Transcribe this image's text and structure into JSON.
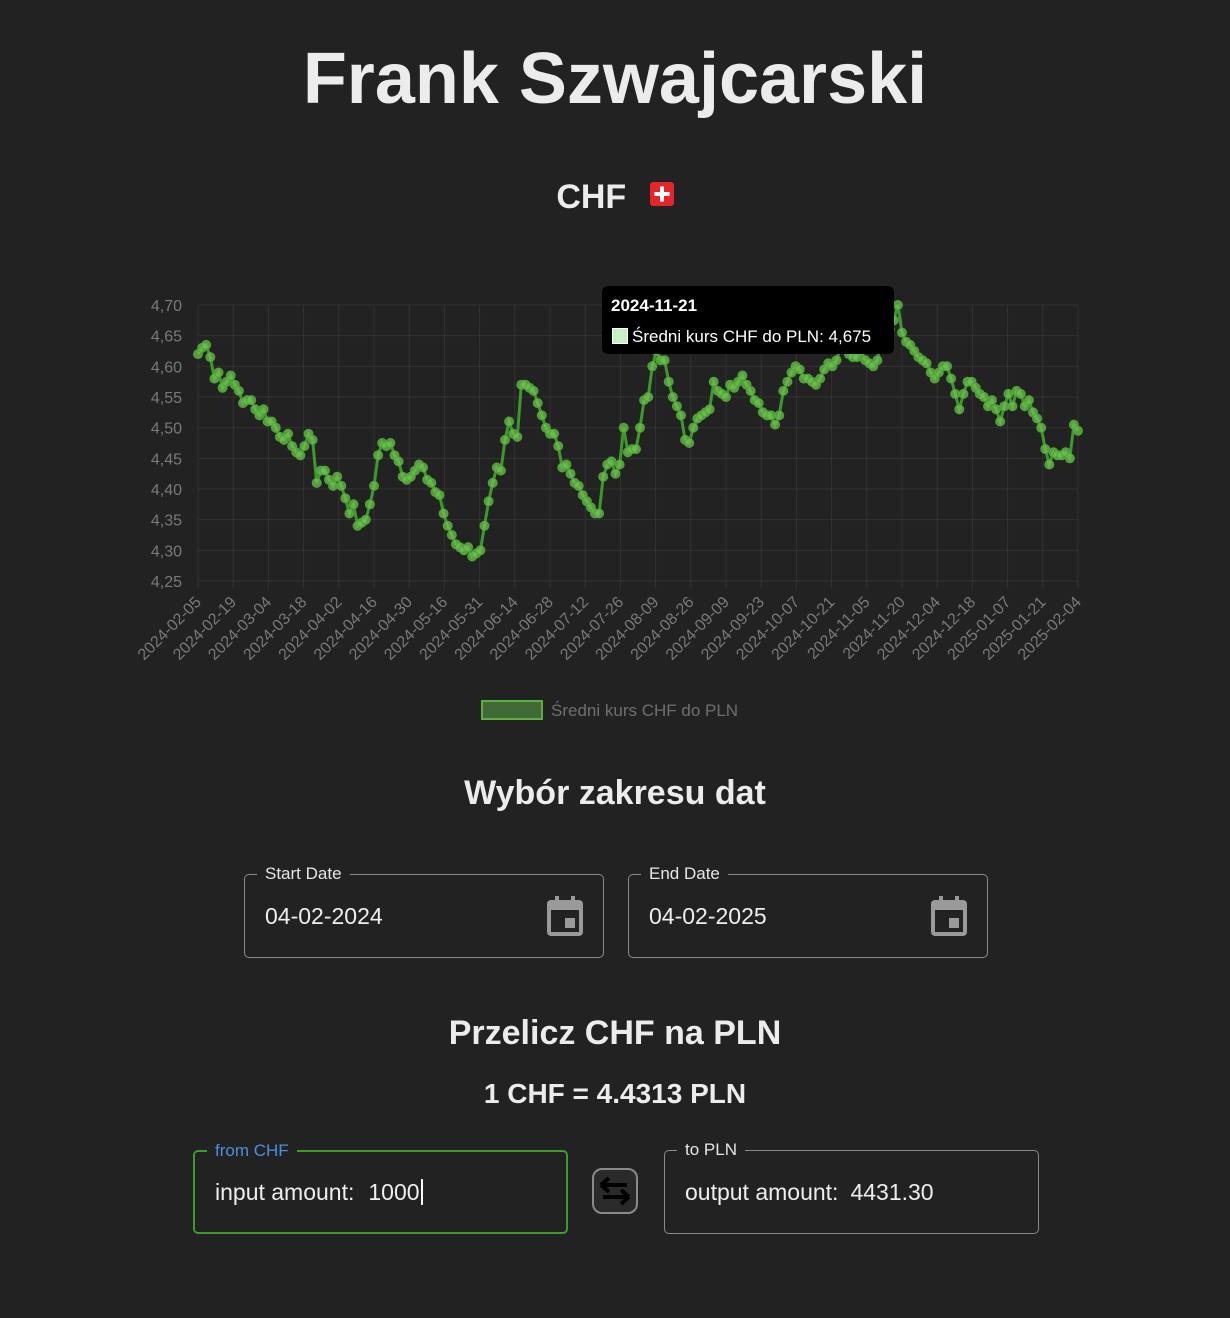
{
  "app_title": "Frank Szwajcarski",
  "currency": {
    "code": "CHF",
    "flag_icon": "swiss-flag-icon"
  },
  "colors": {
    "background": "#222222",
    "line": "#3d9a2a",
    "point": "#6ec24f",
    "focus_border": "#3b9b2b",
    "focus_label": "#4a8fe0"
  },
  "tooltip": {
    "title": "2024-11-21",
    "body": "Średni kurs CHF do PLN: 4,675"
  },
  "chart_data": {
    "type": "line",
    "series_name": "Średni kurs CHF do PLN",
    "y_ticks": [
      "4,70",
      "4,65",
      "4,60",
      "4,55",
      "4,50",
      "4,45",
      "4,40",
      "4,35",
      "4,30",
      "4,25"
    ],
    "ylim": [
      4.25,
      4.7
    ],
    "x_ticks": [
      "2024-02-05",
      "2024-02-19",
      "2024-03-04",
      "2024-03-18",
      "2024-04-02",
      "2024-04-16",
      "2024-04-30",
      "2024-05-16",
      "2024-05-31",
      "2024-06-14",
      "2024-06-28",
      "2024-07-12",
      "2024-07-26",
      "2024-08-09",
      "2024-08-26",
      "2024-09-09",
      "2024-09-23",
      "2024-10-07",
      "2024-10-21",
      "2024-11-05",
      "2024-11-20",
      "2024-12-04",
      "2024-12-18",
      "2025-01-07",
      "2025-01-21",
      "2025-02-04"
    ],
    "legend_position": "bottom",
    "grid": true,
    "values": [
      4.62,
      4.63,
      4.635,
      4.615,
      4.58,
      4.59,
      4.565,
      4.575,
      4.585,
      4.57,
      4.56,
      4.54,
      4.545,
      4.545,
      4.53,
      4.52,
      4.53,
      4.51,
      4.51,
      4.5,
      4.485,
      4.48,
      4.49,
      4.47,
      4.46,
      4.455,
      4.47,
      4.49,
      4.48,
      4.41,
      4.43,
      4.43,
      4.415,
      4.405,
      4.42,
      4.405,
      4.385,
      4.36,
      4.375,
      4.34,
      4.345,
      4.35,
      4.375,
      4.405,
      4.455,
      4.475,
      4.47,
      4.475,
      4.455,
      4.445,
      4.42,
      4.415,
      4.42,
      4.43,
      4.44,
      4.435,
      4.415,
      4.41,
      4.395,
      4.39,
      4.36,
      4.34,
      4.325,
      4.31,
      4.305,
      4.3,
      4.305,
      4.29,
      4.295,
      4.3,
      4.34,
      4.38,
      4.41,
      4.435,
      4.43,
      4.48,
      4.51,
      4.49,
      4.485,
      4.57,
      4.57,
      4.565,
      4.56,
      4.54,
      4.52,
      4.5,
      4.49,
      4.49,
      4.47,
      4.435,
      4.44,
      4.425,
      4.41,
      4.405,
      4.39,
      4.38,
      4.37,
      4.36,
      4.36,
      4.42,
      4.44,
      4.445,
      4.425,
      4.44,
      4.5,
      4.46,
      4.465,
      4.465,
      4.5,
      4.545,
      4.55,
      4.6,
      4.625,
      4.61,
      4.61,
      4.575,
      4.55,
      4.535,
      4.52,
      4.48,
      4.475,
      4.5,
      4.515,
      4.52,
      4.525,
      4.53,
      4.575,
      4.56,
      4.555,
      4.55,
      4.57,
      4.565,
      4.575,
      4.585,
      4.57,
      4.56,
      4.545,
      4.54,
      4.525,
      4.52,
      4.52,
      4.505,
      4.52,
      4.56,
      4.575,
      4.59,
      4.6,
      4.595,
      4.58,
      4.58,
      4.575,
      4.57,
      4.58,
      4.595,
      4.605,
      4.6,
      4.61,
      4.63,
      4.645,
      4.62,
      4.615,
      4.615,
      4.625,
      4.61,
      4.605,
      4.6,
      4.61,
      4.645,
      4.645,
      4.66,
      4.675,
      4.7,
      4.655,
      4.64,
      4.635,
      4.625,
      4.615,
      4.61,
      4.605,
      4.59,
      4.58,
      4.59,
      4.6,
      4.6,
      4.58,
      4.555,
      4.53,
      4.555,
      4.575,
      4.575,
      4.565,
      4.555,
      4.55,
      4.535,
      4.545,
      4.53,
      4.51,
      4.535,
      4.555,
      4.535,
      4.56,
      4.555,
      4.535,
      4.545,
      4.525,
      4.515,
      4.5,
      4.465,
      4.44,
      4.46,
      4.455,
      4.455,
      4.46,
      4.45,
      4.505,
      4.495
    ]
  },
  "date_section": {
    "title": "Wybór zakresu dat",
    "start_label": "Start Date",
    "start_value": "04-02-2024",
    "end_label": "End Date",
    "end_value": "04-02-2025"
  },
  "converter": {
    "title": "Przelicz CHF na PLN",
    "rate_text": "1 CHF = 4.4313 PLN",
    "from_label": "from CHF",
    "input_prefix": "input amount:",
    "input_value": "1000",
    "to_label": "to PLN",
    "output_prefix": "output amount:",
    "output_value": "4431.30",
    "swap_icon": "swap-arrows-icon"
  }
}
